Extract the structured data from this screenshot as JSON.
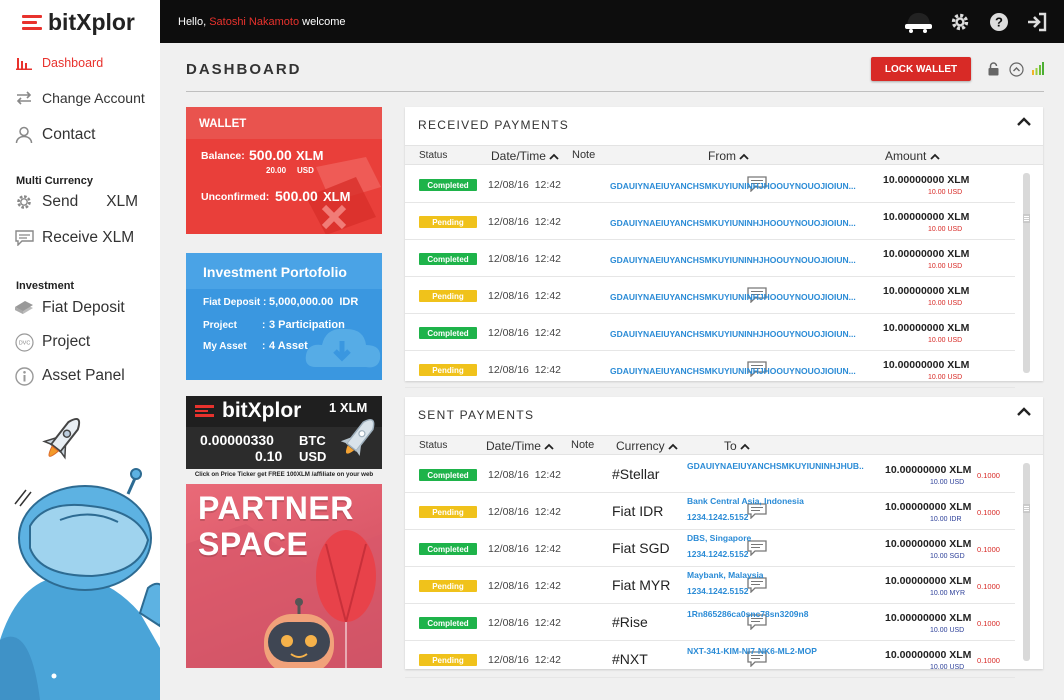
{
  "app": {
    "logo_text": "bitXplor",
    "accent": "#e8322d"
  },
  "header": {
    "greeting_prefix": "Hello, ",
    "user_name": "Satoshi Nakamoto",
    "greeting_suffix": " welcome"
  },
  "sidebar": {
    "items": [
      {
        "label": "Dashboard",
        "icon": "bar-chart-icon",
        "active": true
      },
      {
        "label": "Change Account",
        "icon": "swap-arrows-icon"
      },
      {
        "label": "Contact",
        "icon": "person-icon"
      }
    ],
    "group_multi": "Multi Currency",
    "send": {
      "label": "Send",
      "currency": "XLM",
      "icon": "gear-icon"
    },
    "receive": {
      "label": "Receive XLM",
      "icon": "chat-bubble-icon"
    },
    "group_investment": "Investment",
    "investment_items": [
      {
        "label": "Fiat Deposit",
        "icon": "cash-stack-icon"
      },
      {
        "label": "Project",
        "icon": "dvc-coin-icon"
      },
      {
        "label": "Asset Panel",
        "icon": "info-circle-icon"
      }
    ]
  },
  "main": {
    "title": "DASHBOARD",
    "lock_button": "LOCK WALLET"
  },
  "wallet": {
    "title": "WALLET",
    "balance_label": "Balance:",
    "balance_value": "500.00",
    "balance_unit": "XLM",
    "balance_usd": "20.00",
    "usd_label": "USD",
    "unconfirmed_label": "Unconfirmed:",
    "unconfirmed_value": "500.00",
    "unconfirmed_unit": "XLM"
  },
  "investment": {
    "title": "Investment Portofolio",
    "rows": [
      {
        "label": "Fiat Deposit",
        "sep": ":",
        "value": "5,000,000.00  IDR"
      },
      {
        "label": "Project",
        "sep": ":",
        "value": "3 Participation"
      },
      {
        "label": "My Asset",
        "sep": ":",
        "value": "4 Asset"
      }
    ]
  },
  "ticker": {
    "logo": "bitXplor",
    "unit": "1 XLM",
    "btc_value": "0.00000330",
    "btc_label": "BTC",
    "usd_value": "0.10",
    "usd_label": "USD",
    "note": "Click on Price Ticker  get FREE 100XLM /affiliate on your web"
  },
  "partner": {
    "line1": "PARTNER",
    "line2": "SPACE"
  },
  "received": {
    "title": "RECEIVED PAYMENTS",
    "columns": {
      "status": "Status",
      "datetime": "Date/Time",
      "note": "Note",
      "from": "From",
      "amount": "Amount"
    },
    "rows": [
      {
        "status": "Completed",
        "kind": "c",
        "date": "12/08/16",
        "time": "12:42",
        "note": true,
        "from": "GDAUIYNAEIUYANCHSMKUYIUNINHJHOOUYNOUOJIOIUN...",
        "amount": "10.00000000 XLM",
        "usd": "10.00 USD"
      },
      {
        "status": "Pending",
        "kind": "p",
        "date": "12/08/16",
        "time": "12:42",
        "note": false,
        "from": "GDAUIYNAEIUYANCHSMKUYIUNINHJHOOUYNOUOJIOIUN...",
        "amount": "10.00000000 XLM",
        "usd": "10.00 USD"
      },
      {
        "status": "Completed",
        "kind": "c",
        "date": "12/08/16",
        "time": "12:42",
        "note": false,
        "from": "GDAUIYNAEIUYANCHSMKUYIUNINHJHOOUYNOUOJIOIUN...",
        "amount": "10.00000000 XLM",
        "usd": "10.00 USD"
      },
      {
        "status": "Pending",
        "kind": "p",
        "date": "12/08/16",
        "time": "12:42",
        "note": true,
        "from": "GDAUIYNAEIUYANCHSMKUYIUNINHJHOOUYNOUOJIOIUN...",
        "amount": "10.00000000 XLM",
        "usd": "10.00 USD"
      },
      {
        "status": "Completed",
        "kind": "c",
        "date": "12/08/16",
        "time": "12:42",
        "note": false,
        "from": "GDAUIYNAEIUYANCHSMKUYIUNINHJHOOUYNOUOJIOIUN...",
        "amount": "10.00000000 XLM",
        "usd": "10.00 USD"
      },
      {
        "status": "Pending",
        "kind": "p",
        "date": "12/08/16",
        "time": "12:42",
        "note": true,
        "from": "GDAUIYNAEIUYANCHSMKUYIUNINHJHOOUYNOUOJIOIUN...",
        "amount": "10.00000000 XLM",
        "usd": "10.00 USD"
      }
    ]
  },
  "sent": {
    "title": "SENT PAYMENTS",
    "columns": {
      "status": "Status",
      "datetime": "Date/Time",
      "note": "Note",
      "currency": "Currency",
      "to": "To"
    },
    "rows": [
      {
        "status": "Completed",
        "kind": "c",
        "date": "12/08/16",
        "time": "12:42",
        "note": false,
        "currency": "#Stellar",
        "to1": "GDAUIYNAEIUYANCHSMKUYIUNINHJHUB..",
        "to2": "",
        "amount": "10.00000000 XLM",
        "sub": "10.00 USD",
        "rate": "0.1000"
      },
      {
        "status": "Pending",
        "kind": "p",
        "date": "12/08/16",
        "time": "12:42",
        "note": true,
        "currency": "Fiat IDR",
        "to1": "Bank Central Asia, Indonesia",
        "to2": "1234.1242.5152",
        "amount": "10.00000000 XLM",
        "sub": "10.00 IDR",
        "rate": "0.1000"
      },
      {
        "status": "Completed",
        "kind": "c",
        "date": "12/08/16",
        "time": "12:42",
        "note": true,
        "currency": "Fiat SGD",
        "to1": "DBS, Singapore",
        "to2": "1234.1242.5152",
        "amount": "10.00000000 XLM",
        "sub": "10.00 SGD",
        "rate": "0.1000"
      },
      {
        "status": "Pending",
        "kind": "p",
        "date": "12/08/16",
        "time": "12:42",
        "note": true,
        "currency": "Fiat MYR",
        "to1": "Maybank, Malaysia",
        "to2": "1234.1242.5152",
        "amount": "10.00000000 XLM",
        "sub": "10.00 MYR",
        "rate": "0.1000"
      },
      {
        "status": "Completed",
        "kind": "c",
        "date": "12/08/16",
        "time": "12:42",
        "note": true,
        "currency": "#Rise",
        "to1": "1Rn865286ca0snc78sn3209n8",
        "to2": "",
        "amount": "10.00000000 XLM",
        "sub": "10.00 USD",
        "rate": "0.1000"
      },
      {
        "status": "Pending",
        "kind": "p",
        "date": "12/08/16",
        "time": "12:42",
        "note": true,
        "currency": "#NXT",
        "to1": "NXT-341-KIM-NI7-NK6-ML2-MOP",
        "to2": "",
        "amount": "10.00000000 XLM",
        "sub": "10.00 USD",
        "rate": "0.1000"
      }
    ]
  }
}
